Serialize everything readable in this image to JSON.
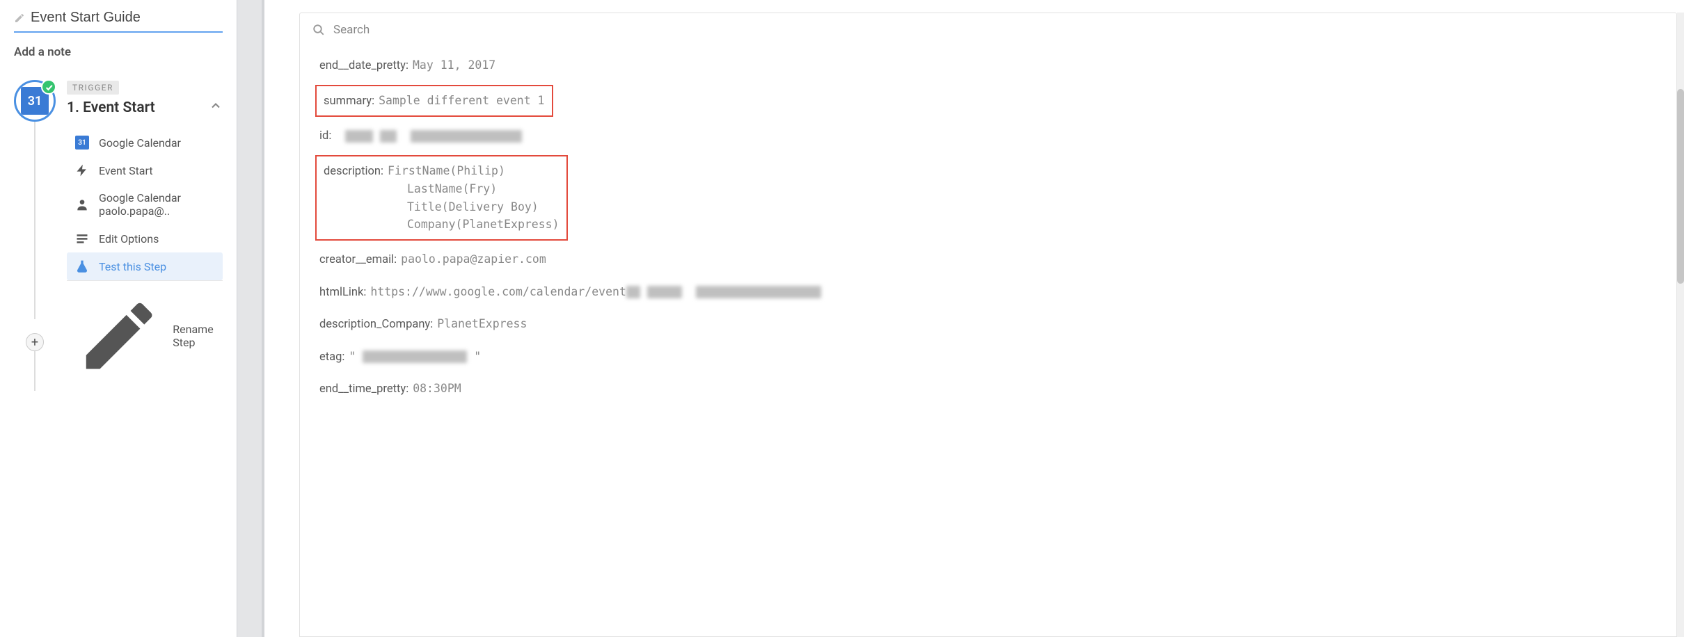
{
  "left": {
    "title_input_value": "Event Start Guide",
    "add_note": "Add a note",
    "circle_day": "31",
    "tag": "TRIGGER",
    "step_title": "1. Event Start",
    "substeps": {
      "google_calendar": "Google Calendar",
      "gc_box": "31",
      "event_start": "Event Start",
      "account": "Google Calendar paolo.papa@..",
      "edit_options": "Edit Options",
      "test_step": "Test this Step"
    },
    "rename": "Rename Step"
  },
  "search": {
    "placeholder": "Search"
  },
  "fields": {
    "end_date_pretty_k": "end__date_pretty",
    "end_date_pretty_v": "May 11, 2017",
    "summary_k": "summary",
    "summary_v": "Sample different event 1",
    "id_k": "id",
    "description_k": "description",
    "description_l1": "FirstName(Philip)",
    "description_l2": "LastName(Fry)",
    "description_l3": "Title(Delivery Boy)",
    "description_l4": "Company(PlanetExpress)",
    "creator_email_k": "creator__email",
    "creator_email_v": "paolo.papa@zapier.com",
    "htmlLink_k": "htmlLink",
    "htmlLink_v": "https://www.google.com/calendar/event",
    "description_Company_k": "description_Company",
    "description_Company_v": "PlanetExpress",
    "etag_k": "etag",
    "etag_v": "\" ",
    "end_time_pretty_k": "end__time_pretty",
    "end_time_pretty_v": "08:30PM"
  }
}
